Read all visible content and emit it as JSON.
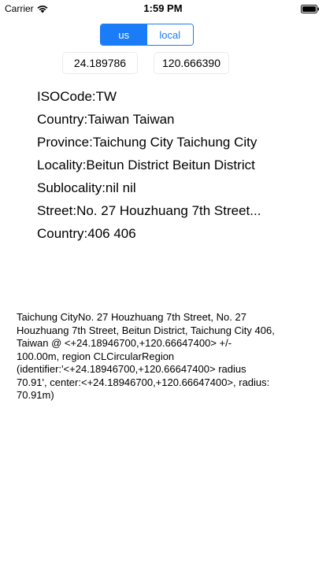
{
  "status_bar": {
    "carrier": "Carrier",
    "time": "1:59 PM",
    "wifi_icon": "wifi-icon",
    "battery_icon": "battery-icon"
  },
  "segmented_control": {
    "options": [
      "us",
      "local"
    ],
    "selected": "us",
    "accent_color": "#1a7cf7"
  },
  "coordinates": {
    "latitude": "24.189786",
    "longitude": "120.666390"
  },
  "info": [
    "ISOCode:TW",
    "Country:Taiwan Taiwan",
    "Province:Taichung City Taichung City",
    "Locality:Beitun District Beitun District",
    "Sublocality:nil nil",
    "Street:No. 27 Houzhuang 7th Street...",
    "Country:406 406"
  ],
  "description": "Taichung CityNo. 27 Houzhuang 7th Street, No. 27 Houzhuang 7th Street, Beitun District, Taichung City 406, Taiwan @ <+24.18946700,+120.66647400> +/- 100.00m, region CLCircularRegion (identifier:'<+24.18946700,+120.66647400> radius 70.91', center:<+24.18946700,+120.66647400>, radius: 70.91m)"
}
